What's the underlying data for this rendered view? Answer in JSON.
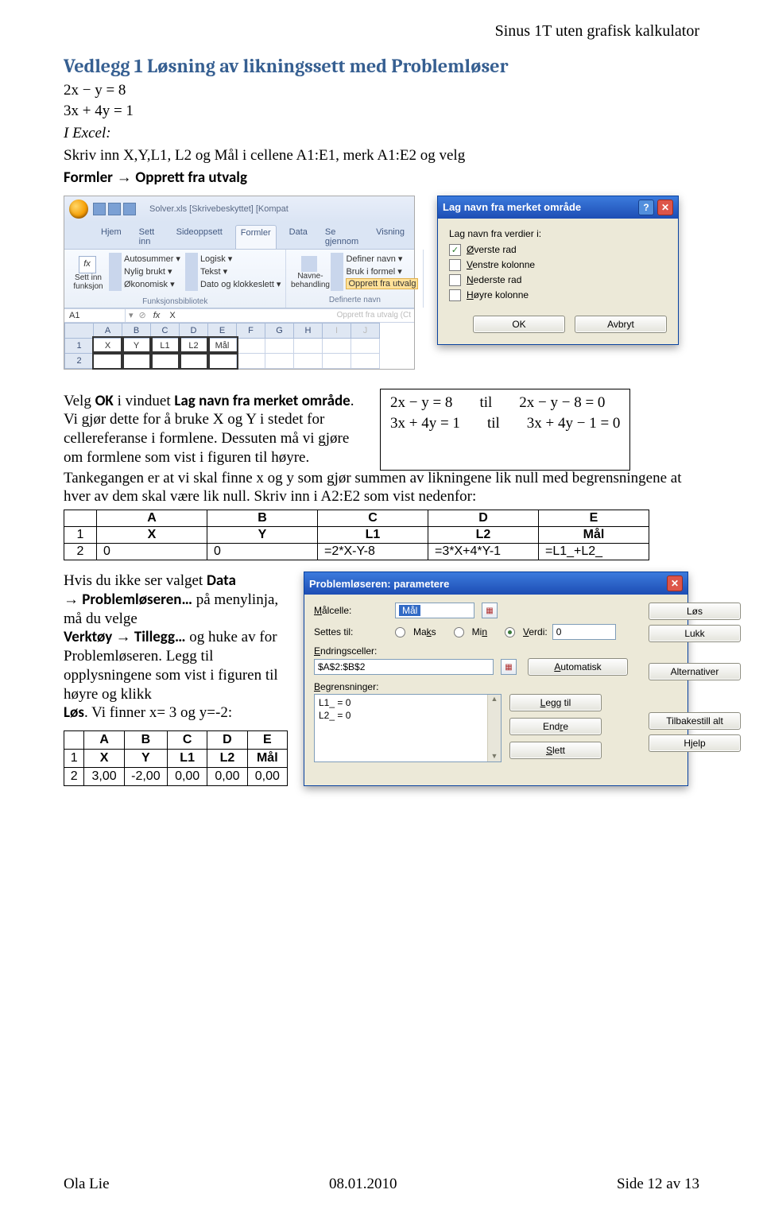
{
  "header": {
    "right": "Sinus 1T uten grafisk kalkulator"
  },
  "title": "Vedlegg 1 Løsning av likningssett med Problemløser",
  "eqs_top": [
    "2x − y = 8",
    "3x + 4y = 1"
  ],
  "intro": {
    "in_excel": "I Excel:",
    "line1": "Skriv inn X,Y,L1, L2 og Mål i cellene A1:E1, merk A1:E2 og velg",
    "nav_formler": "Formler",
    "arrow": "→",
    "nav_opprett": "Opprett fra utvalg"
  },
  "excel": {
    "title": "Solver.xls  [Skrivebeskyttet]  [Kompat",
    "tabs": [
      "Hjem",
      "Sett inn",
      "Sideoppsett",
      "Formler",
      "Data",
      "Se gjennom",
      "Visning"
    ],
    "fnGroup": {
      "big": "Sett inn funksjon",
      "items": [
        "Autosummer",
        "Nylig brukt",
        "Økonomisk"
      ],
      "items2": [
        "Logisk",
        "Tekst",
        "Dato og klokkeslett"
      ],
      "title": "Funksjonsbibliotek"
    },
    "nameGroup": {
      "big": "Navne-behandling",
      "items": [
        "Definer navn",
        "Bruk i formel",
        "Opprett fra utvalg"
      ],
      "title": "Definerte navn"
    },
    "nameBox": "A1",
    "fxVal": "X",
    "cols": [
      "A",
      "B",
      "C",
      "D",
      "E",
      "F",
      "G",
      "H",
      "I",
      "J"
    ],
    "row1": [
      "X",
      "Y",
      "L1",
      "L2",
      "Mål"
    ],
    "ghost": "Opprett fra utvalg (Ct"
  },
  "dlgNames": {
    "title": "Lag navn fra merket område",
    "legend": "Lag navn fra verdier i:",
    "opts": [
      {
        "label": "Øverste rad",
        "checked": true,
        "u": "Ø"
      },
      {
        "label": "Venstre kolonne",
        "checked": false,
        "u": "V"
      },
      {
        "label": "Nederste rad",
        "checked": false,
        "u": "N"
      },
      {
        "label": "Høyre kolonne",
        "checked": false,
        "u": "H"
      }
    ],
    "ok": "OK",
    "cancel": "Avbryt"
  },
  "mid": {
    "p1a": "Velg ",
    "p1b": "OK",
    "p1c": " i vinduet ",
    "p1d": "Lag navn fra merket område",
    "p1e": ". Vi gjør dette for å bruke X og Y i stedet for cellereferanse i formlene. Dessuten må vi gjøre om formlene som vist i figuren til høyre. ",
    "p2": "Tankegangen er at vi skal finne x og y som gjør summen av likningene lik null med begrensningene at hver av dem skal være lik null. Skriv inn i A2:E2 som vist nedenfor:"
  },
  "eqBox": {
    "r1l": "2x − y = 8",
    "r1m": "til",
    "r1r": "2x − y − 8 = 0",
    "r2l": "3x + 4y = 1",
    "r2m": "til",
    "r2r": "3x + 4y − 1 = 0"
  },
  "formulaTable": {
    "cols": [
      "A",
      "B",
      "C",
      "D",
      "E"
    ],
    "row1": [
      "X",
      "Y",
      "L1",
      "L2",
      "Mål"
    ],
    "row2": [
      "0",
      "0",
      "=2*X-Y-8",
      "=3*X+4*Y-1",
      "=L1_+L2_"
    ]
  },
  "solveText": {
    "p_a": "Hvis du ikke ser valget ",
    "p_data": "Data",
    "p_b_arrow": "→",
    "p_probl": " Problemløseren…",
    "p_c": " på menylinja, må du velge ",
    "p_verk": "Verktøy ",
    "p_d_arrow": "→",
    "p_tillegg": " Tillegg…",
    "p_e": " og huke av for Problemløseren. Legg til opplysningene som vist i figuren til høyre og klikk ",
    "p_los": "Løs",
    "p_f": ". Vi finner x= 3 og y=-2:"
  },
  "resultTable": {
    "cols": [
      "A",
      "B",
      "C",
      "D",
      "E"
    ],
    "row1": [
      "X",
      "Y",
      "L1",
      "L2",
      "Mål"
    ],
    "row2": [
      "3,00",
      "-2,00",
      "0,00",
      "0,00",
      "0,00"
    ]
  },
  "solver": {
    "title": "Problemløseren: parametere",
    "malcelle": "Målcelle:",
    "malVal": "Mål",
    "settes": "Settes til:",
    "maks": "Maks",
    "min": "Min",
    "verdi": "Verdi:",
    "verdiVal": "0",
    "endr": "Endringsceller:",
    "endrVal": "$A$2:$B$2",
    "auto": "Automatisk",
    "begr": "Begrensninger:",
    "list": [
      "L1_ = 0",
      "L2_ = 0"
    ],
    "btns": {
      "los": "Løs",
      "lukk": "Lukk",
      "alt": "Alternativer",
      "legg": "Legg til",
      "endre": "Endre",
      "slett": "Slett",
      "tilbake": "Tilbakestill alt",
      "hjelp": "Hjelp"
    }
  },
  "icons": {
    "help": "?",
    "close": "✕",
    "check": "✓",
    "up": "▲",
    "down": "▼"
  },
  "footer": {
    "left": "Ola Lie",
    "mid": "08.01.2010",
    "right": "Side 12 av 13"
  }
}
